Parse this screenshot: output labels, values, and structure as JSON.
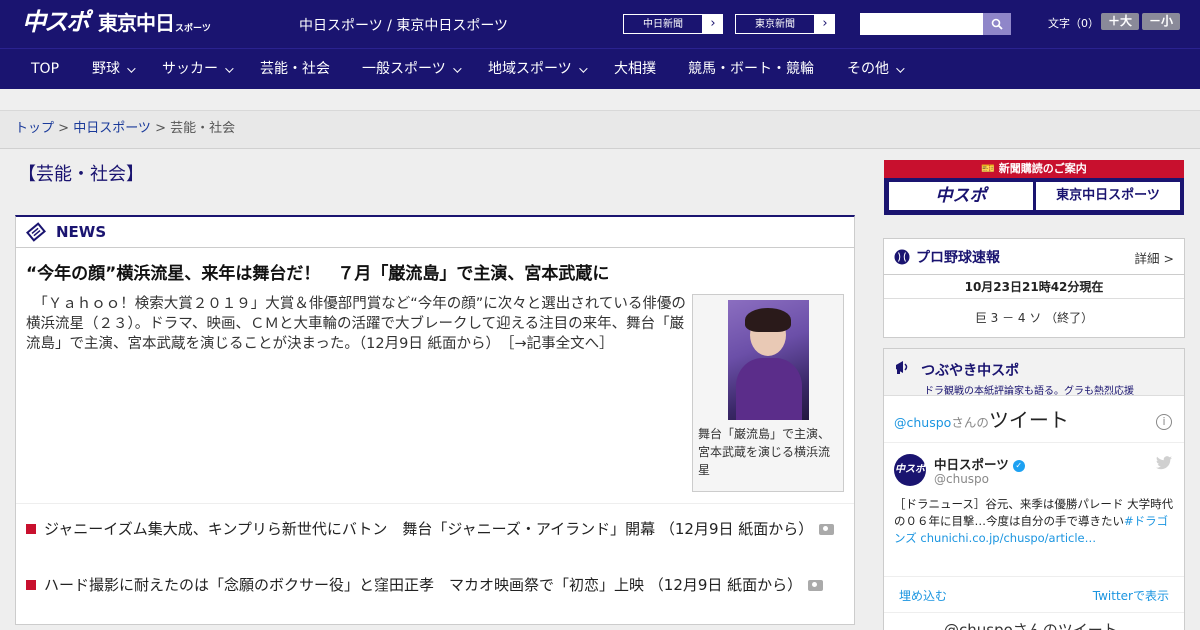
{
  "header": {
    "logo": {
      "main": "中スポ",
      "sub": "東京中日",
      "sub_small": "スポーツ"
    },
    "site_links": "中日スポーツ / 東京中日スポーツ",
    "ext_links": [
      "中日新聞",
      "東京新聞"
    ],
    "search_placeholder": "",
    "font_size_label": "文字（0）",
    "font_up_label": "＋大",
    "font_down_label": "－小"
  },
  "nav": [
    {
      "label": "TOP",
      "has_dropdown": false
    },
    {
      "label": "野球",
      "has_dropdown": true
    },
    {
      "label": "サッカー",
      "has_dropdown": true
    },
    {
      "label": "芸能・社会",
      "has_dropdown": false
    },
    {
      "label": "一般スポーツ",
      "has_dropdown": true
    },
    {
      "label": "地域スポーツ",
      "has_dropdown": true
    },
    {
      "label": "大相撲",
      "has_dropdown": false
    },
    {
      "label": "競馬・ボート・競輪",
      "has_dropdown": false
    },
    {
      "label": "その他",
      "has_dropdown": true
    }
  ],
  "breadcrumb": {
    "home": "トップ",
    "sep": " > ",
    "parent": "中日スポーツ",
    "current": "芸能・社会"
  },
  "section_title": "【芸能・社会】",
  "news": {
    "heading": "NEWS",
    "lead": {
      "title": "“今年の顔”横浜流星、来年は舞台だ！　７月「巌流島」で主演、宮本武蔵に",
      "body": "　「Ｙａｈｏｏ！検索大賞２０１９」大賞＆俳優部門賞など“今年の顔”に次々と選出されている俳優の横浜流星（２３）。ドラマ、映画、ＣＭと大車輪の活躍で大ブレークして迎える注目の来年、舞台「巌流島」で主演、宮本武蔵を演じることが決まった。（12月9日 紙面から）　［→記事全文へ］",
      "photo_caption": "舞台「巌流島」で主演、宮本武蔵を演じる横浜流星"
    },
    "items": [
      {
        "text": "ジャニーイズム集大成、キンプリら新世代にバトン　舞台「ジャニーズ・アイランド」開幕 （12月9日 紙面から）"
      },
      {
        "text": "ハード撮影に耐えたのは「念願のボクサー役」と窪田正孝　マカオ映画祭で「初恋」上映 （12月9日 紙面から）"
      }
    ]
  },
  "promo": {
    "title": "新聞購読のご案内",
    "buttons": [
      "中スポ",
      "東京中日スポーツ"
    ]
  },
  "baseball": {
    "title": "プロ野球速報",
    "more": "詳細 >",
    "time": "10月23日21時42分現在",
    "score": "巨 3 － 4 ソ （終了）"
  },
  "tweet": {
    "title": "つぶやき中スポ",
    "subtitle": "ドラ観戦の本紙評論家も語る。グラも熱烈応援",
    "handle_prefix": "@chuspo",
    "handle_suffix": "さんの",
    "handle_big": "ツイート",
    "info": "i",
    "avatar_text": "中スポ",
    "name": "中日スポーツ",
    "at": "@chuspo",
    "text": "［ドラニュース］谷元、来季は優勝パレード 大学時代の０６年に目撃…今度は自分の手で導きたい",
    "text_link": "#ドラゴンズ chunichi.co.jp/chuspo/article…",
    "embed": "埋め込む",
    "view": "Twitterで表示",
    "handle2": "@chuspoさんのツイート"
  },
  "colors": {
    "navy": "#1a1470",
    "red": "#c8102e",
    "twitter_blue": "#1b95e0"
  }
}
